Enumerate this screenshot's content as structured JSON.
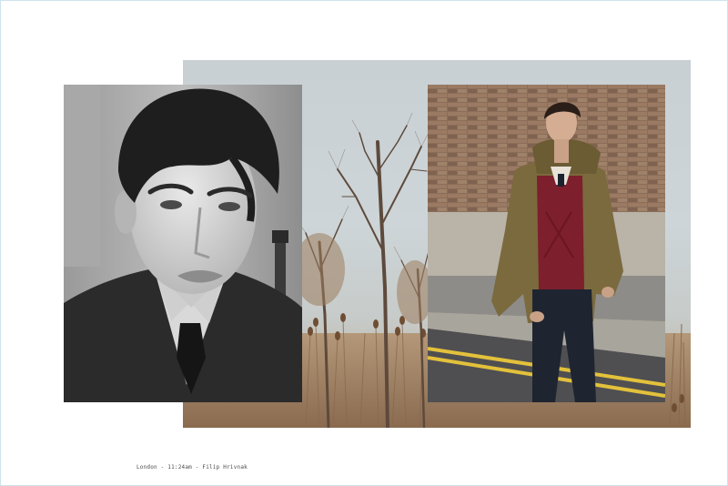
{
  "caption": {
    "text": "London - 11:24am - Filip Hrivnak"
  },
  "colors": {
    "page_background": "#ffffff",
    "frame_border": "#cfe3ea",
    "sky": "#c8d0d4",
    "dry_grass": "#a88766",
    "brick_wall": "#8a6b55",
    "coat": "#7a6a3e",
    "sweater": "#7d1f2c",
    "trousers": "#1e2430",
    "road_line": "#e3c13b"
  },
  "images": {
    "left": "black-and-white-portrait",
    "center": "bare-trees-landscape",
    "right": "street-fashion-portrait"
  }
}
